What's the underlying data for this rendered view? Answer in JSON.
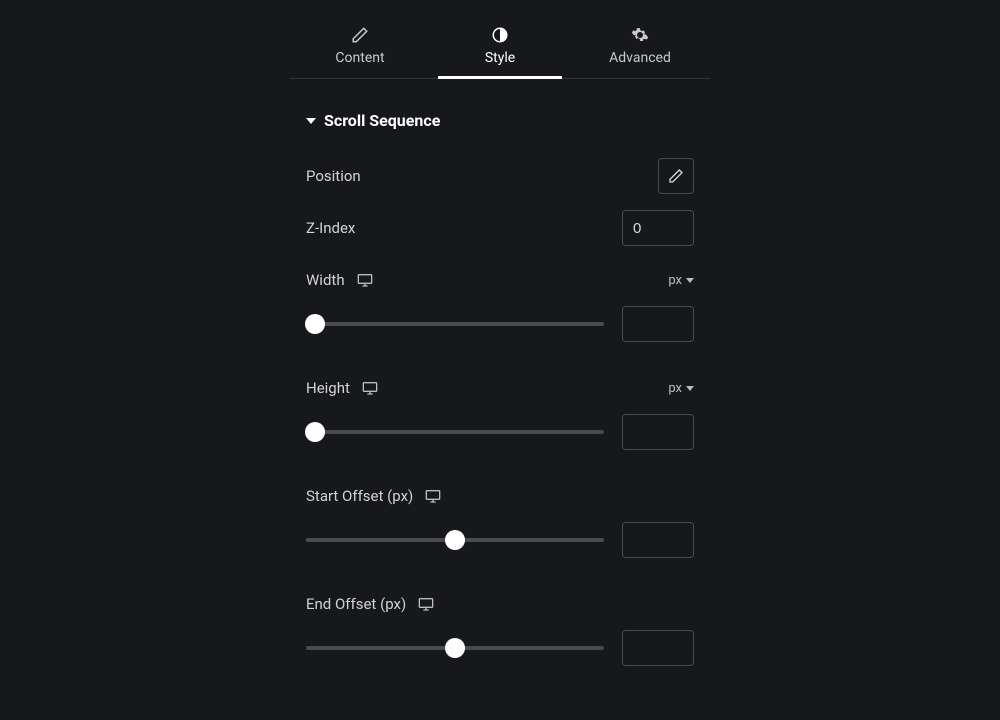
{
  "tabs": {
    "content": "Content",
    "style": "Style",
    "advanced": "Advanced"
  },
  "section": {
    "title": "Scroll Sequence"
  },
  "controls": {
    "position": {
      "label": "Position"
    },
    "zindex": {
      "label": "Z-Index",
      "value": "0"
    },
    "width": {
      "label": "Width",
      "unit": "px",
      "value": "",
      "slider_pct": 3
    },
    "height": {
      "label": "Height",
      "unit": "px",
      "value": "",
      "slider_pct": 3
    },
    "start_offset": {
      "label": "Start Offset (px)",
      "value": "",
      "slider_pct": 50
    },
    "end_offset": {
      "label": "End Offset (px)",
      "value": "",
      "slider_pct": 50
    }
  }
}
